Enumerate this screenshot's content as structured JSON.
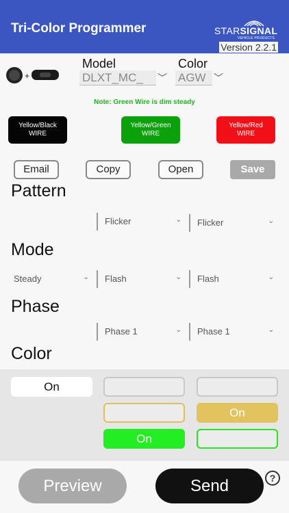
{
  "header": {
    "title": "Tri-Color Programmer",
    "logo_star": "STAR",
    "logo_signal": "SIGNAL",
    "logo_sub": "VEHICLE PRODUCTS",
    "version": "Version 2.2.1"
  },
  "model": {
    "label": "Model",
    "value": "DLXT_MC_"
  },
  "color_select": {
    "label": "Color",
    "value": "AGW"
  },
  "note": "Note: Green Wire is dim steady",
  "wires": [
    {
      "label_top": "Yellow/Black",
      "label_bottom": "WIRE",
      "color": "#050505"
    },
    {
      "label_top": "Yellow/Green",
      "label_bottom": "WIRE",
      "color": "#0aa10a"
    },
    {
      "label_top": "Yellow/Red",
      "label_bottom": "WIRE",
      "color": "#f20f17"
    }
  ],
  "actions": {
    "email": "Email",
    "copy": "Copy",
    "open": "Open",
    "save": "Save"
  },
  "sections": {
    "pattern": "Pattern",
    "mode": "Mode",
    "phase": "Phase",
    "color": "Color"
  },
  "pattern": {
    "col2": "Flicker",
    "col3": "Flicker"
  },
  "mode": {
    "col1": "Steady",
    "col2": "Flash",
    "col3": "Flash"
  },
  "phase": {
    "col2": "Phase 1",
    "col3": "Phase 1"
  },
  "color_grid": {
    "white_on": "On",
    "amber_on": "On",
    "green_on": "On"
  },
  "colors": {
    "accent": "#3b56c0",
    "amber": "#e6c45a",
    "green": "#22ee22"
  },
  "bottom": {
    "preview": "Preview",
    "send": "Send",
    "help": "?"
  }
}
